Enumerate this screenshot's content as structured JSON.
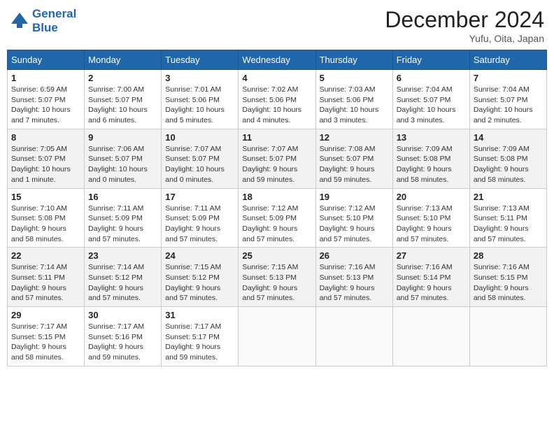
{
  "header": {
    "logo_line1": "General",
    "logo_line2": "Blue",
    "month": "December 2024",
    "location": "Yufu, Oita, Japan"
  },
  "weekdays": [
    "Sunday",
    "Monday",
    "Tuesday",
    "Wednesday",
    "Thursday",
    "Friday",
    "Saturday"
  ],
  "weeks": [
    [
      {
        "day": "1",
        "info": "Sunrise: 6:59 AM\nSunset: 5:07 PM\nDaylight: 10 hours\nand 7 minutes."
      },
      {
        "day": "2",
        "info": "Sunrise: 7:00 AM\nSunset: 5:07 PM\nDaylight: 10 hours\nand 6 minutes."
      },
      {
        "day": "3",
        "info": "Sunrise: 7:01 AM\nSunset: 5:06 PM\nDaylight: 10 hours\nand 5 minutes."
      },
      {
        "day": "4",
        "info": "Sunrise: 7:02 AM\nSunset: 5:06 PM\nDaylight: 10 hours\nand 4 minutes."
      },
      {
        "day": "5",
        "info": "Sunrise: 7:03 AM\nSunset: 5:06 PM\nDaylight: 10 hours\nand 3 minutes."
      },
      {
        "day": "6",
        "info": "Sunrise: 7:04 AM\nSunset: 5:07 PM\nDaylight: 10 hours\nand 3 minutes."
      },
      {
        "day": "7",
        "info": "Sunrise: 7:04 AM\nSunset: 5:07 PM\nDaylight: 10 hours\nand 2 minutes."
      }
    ],
    [
      {
        "day": "8",
        "info": "Sunrise: 7:05 AM\nSunset: 5:07 PM\nDaylight: 10 hours\nand 1 minute."
      },
      {
        "day": "9",
        "info": "Sunrise: 7:06 AM\nSunset: 5:07 PM\nDaylight: 10 hours\nand 0 minutes."
      },
      {
        "day": "10",
        "info": "Sunrise: 7:07 AM\nSunset: 5:07 PM\nDaylight: 10 hours\nand 0 minutes."
      },
      {
        "day": "11",
        "info": "Sunrise: 7:07 AM\nSunset: 5:07 PM\nDaylight: 9 hours\nand 59 minutes."
      },
      {
        "day": "12",
        "info": "Sunrise: 7:08 AM\nSunset: 5:07 PM\nDaylight: 9 hours\nand 59 minutes."
      },
      {
        "day": "13",
        "info": "Sunrise: 7:09 AM\nSunset: 5:08 PM\nDaylight: 9 hours\nand 58 minutes."
      },
      {
        "day": "14",
        "info": "Sunrise: 7:09 AM\nSunset: 5:08 PM\nDaylight: 9 hours\nand 58 minutes."
      }
    ],
    [
      {
        "day": "15",
        "info": "Sunrise: 7:10 AM\nSunset: 5:08 PM\nDaylight: 9 hours\nand 58 minutes."
      },
      {
        "day": "16",
        "info": "Sunrise: 7:11 AM\nSunset: 5:09 PM\nDaylight: 9 hours\nand 57 minutes."
      },
      {
        "day": "17",
        "info": "Sunrise: 7:11 AM\nSunset: 5:09 PM\nDaylight: 9 hours\nand 57 minutes."
      },
      {
        "day": "18",
        "info": "Sunrise: 7:12 AM\nSunset: 5:09 PM\nDaylight: 9 hours\nand 57 minutes."
      },
      {
        "day": "19",
        "info": "Sunrise: 7:12 AM\nSunset: 5:10 PM\nDaylight: 9 hours\nand 57 minutes."
      },
      {
        "day": "20",
        "info": "Sunrise: 7:13 AM\nSunset: 5:10 PM\nDaylight: 9 hours\nand 57 minutes."
      },
      {
        "day": "21",
        "info": "Sunrise: 7:13 AM\nSunset: 5:11 PM\nDaylight: 9 hours\nand 57 minutes."
      }
    ],
    [
      {
        "day": "22",
        "info": "Sunrise: 7:14 AM\nSunset: 5:11 PM\nDaylight: 9 hours\nand 57 minutes."
      },
      {
        "day": "23",
        "info": "Sunrise: 7:14 AM\nSunset: 5:12 PM\nDaylight: 9 hours\nand 57 minutes."
      },
      {
        "day": "24",
        "info": "Sunrise: 7:15 AM\nSunset: 5:12 PM\nDaylight: 9 hours\nand 57 minutes."
      },
      {
        "day": "25",
        "info": "Sunrise: 7:15 AM\nSunset: 5:13 PM\nDaylight: 9 hours\nand 57 minutes."
      },
      {
        "day": "26",
        "info": "Sunrise: 7:16 AM\nSunset: 5:13 PM\nDaylight: 9 hours\nand 57 minutes."
      },
      {
        "day": "27",
        "info": "Sunrise: 7:16 AM\nSunset: 5:14 PM\nDaylight: 9 hours\nand 57 minutes."
      },
      {
        "day": "28",
        "info": "Sunrise: 7:16 AM\nSunset: 5:15 PM\nDaylight: 9 hours\nand 58 minutes."
      }
    ],
    [
      {
        "day": "29",
        "info": "Sunrise: 7:17 AM\nSunset: 5:15 PM\nDaylight: 9 hours\nand 58 minutes."
      },
      {
        "day": "30",
        "info": "Sunrise: 7:17 AM\nSunset: 5:16 PM\nDaylight: 9 hours\nand 59 minutes."
      },
      {
        "day": "31",
        "info": "Sunrise: 7:17 AM\nSunset: 5:17 PM\nDaylight: 9 hours\nand 59 minutes."
      },
      null,
      null,
      null,
      null
    ]
  ]
}
